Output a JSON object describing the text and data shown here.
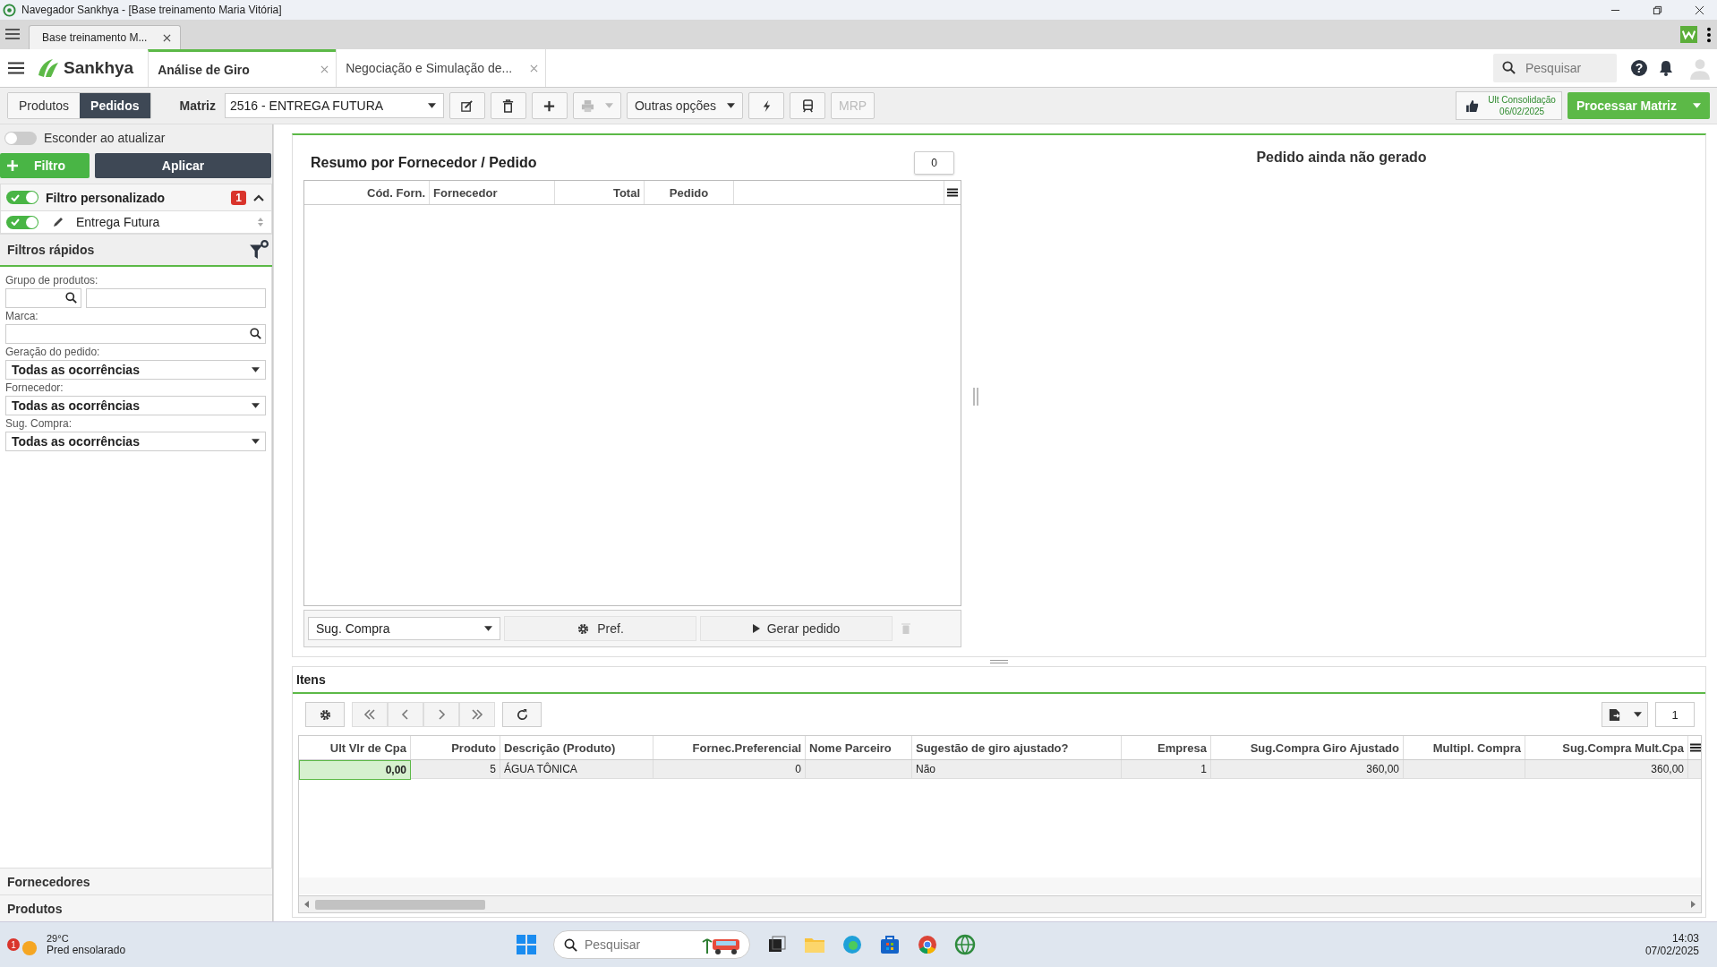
{
  "window": {
    "title": "Navegador Sankhya - [Base treinamento Maria Vitória]"
  },
  "browser": {
    "tab_title": "Base treinamento M..."
  },
  "app": {
    "brand": "Sankhya",
    "tabs": [
      {
        "label": "Análise de Giro",
        "selected": true
      },
      {
        "label": "Negociação e Simulação de...",
        "selected": false
      }
    ],
    "search": {
      "placeholder": "Pesquisar"
    },
    "help": "?"
  },
  "toolbar": {
    "segments": [
      {
        "label": "Produtos",
        "selected": false
      },
      {
        "label": "Pedidos",
        "selected": true
      }
    ],
    "matriz_label": "Matriz",
    "matriz_value": "2516 - ENTREGA FUTURA",
    "other_options": "Outras opções",
    "mrp": {
      "label": "MRP",
      "disabled": true
    },
    "consolidation_label": "Ult Consolidação",
    "consolidation_date": "06/02/2025",
    "process_button": "Processar Matriz"
  },
  "sidebar": {
    "hide_toggle": {
      "label": "Esconder ao atualizar",
      "on": false
    },
    "filter_button": "Filtro",
    "apply_button": "Aplicar",
    "filters": [
      {
        "label": "Filtro personalizado",
        "on": true,
        "badge": "1",
        "kind": "group"
      },
      {
        "label": "Entrega Futura",
        "on": true,
        "kind": "item"
      }
    ],
    "quick_filters_title": "Filtros rápidos",
    "fields": [
      {
        "label": "Grupo de produtos:",
        "kind": "lookup-pair"
      },
      {
        "label": "Marca:",
        "kind": "lookup"
      },
      {
        "label": "Geração do pedido:",
        "kind": "select",
        "value": "Todas as ocorrências"
      },
      {
        "label": "Fornecedor:",
        "kind": "select",
        "value": "Todas as ocorrências"
      },
      {
        "label": "Sug. Compra:",
        "kind": "select",
        "value": "Todas as ocorrências"
      }
    ],
    "sections": [
      "Fornecedores",
      "Produtos"
    ]
  },
  "summary": {
    "title": "Resumo por Fornecedor / Pedido",
    "count": "0",
    "columns": [
      "Cód. Forn.",
      "Fornecedor",
      "Total",
      "Pedido"
    ],
    "footer_select": "Sug. Compra",
    "pref_button": "Pref.",
    "generate_button": "Gerar pedido",
    "message": "Pedido ainda não gerado"
  },
  "items": {
    "title": "Itens",
    "page": "1",
    "columns": [
      "Ult Vlr de Cpa",
      "Produto",
      "Descrição (Produto)",
      "Fornec.Preferencial",
      "Nome Parceiro",
      "Sugestão de giro ajustado?",
      "Empresa",
      "Sug.Compra Giro Ajustado",
      "Multipl. Compra",
      "Sug.Compra Mult.Cpa"
    ],
    "rows": [
      {
        "cells": [
          {
            "text": "0,00",
            "selected": true
          },
          {
            "text": "5",
            "selected": false
          },
          {
            "text": "ÁGUA TÔNICA",
            "selected": false
          },
          {
            "text": "0",
            "selected": false
          },
          {
            "selected": false
          },
          {
            "text": "Não",
            "selected": false
          },
          {
            "text": "1",
            "selected": false
          },
          {
            "text": "360,00",
            "selected": false
          },
          {
            "selected": false
          },
          {
            "text": "360,00",
            "selected": false
          }
        ]
      }
    ]
  },
  "taskbar": {
    "temperature": "29°C",
    "weather": "Pred ensolarado",
    "weather_badge": "1",
    "search_placeholder": "Pesquisar",
    "time": "14:03",
    "date": "07/02/2025"
  }
}
